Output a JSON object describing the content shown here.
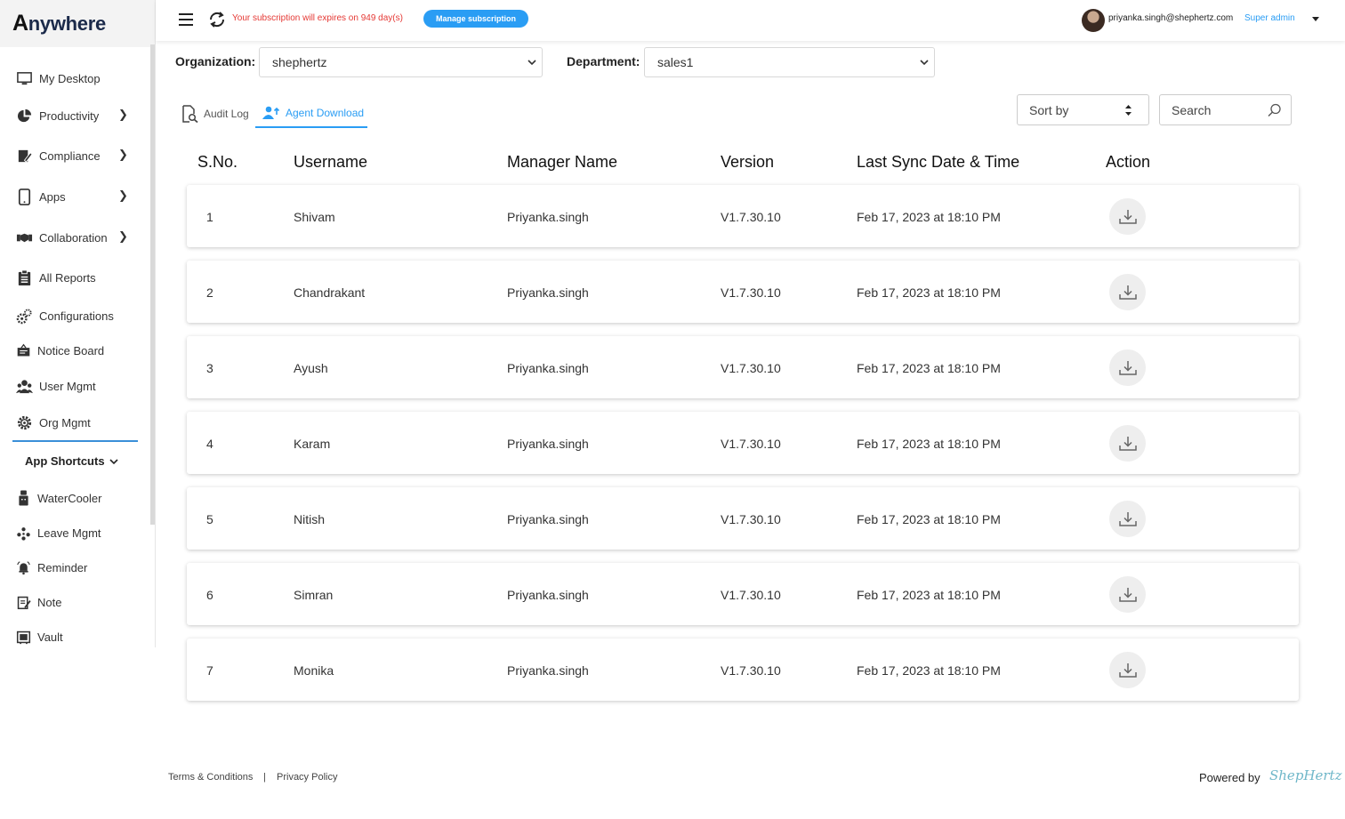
{
  "app": {
    "logo_letter": "A",
    "logo_rest": "nywhere"
  },
  "sidebar": {
    "items": [
      {
        "label": "My Desktop",
        "icon": "desktop-icon",
        "has_arrow": false
      },
      {
        "label": "Productivity",
        "icon": "pie-chart-icon",
        "has_arrow": true
      },
      {
        "label": "Compliance",
        "icon": "compliance-icon",
        "has_arrow": true
      },
      {
        "label": "Apps",
        "icon": "mobile-icon",
        "has_arrow": true
      },
      {
        "label": "Collaboration",
        "icon": "handshake-icon",
        "has_arrow": true
      },
      {
        "label": "All Reports",
        "icon": "clipboard-icon",
        "has_arrow": false
      },
      {
        "label": "Configurations",
        "icon": "gears-icon",
        "has_arrow": false
      },
      {
        "label": "Notice Board",
        "icon": "notice-board-icon",
        "has_arrow": false
      },
      {
        "label": "User Mgmt",
        "icon": "users-icon",
        "has_arrow": false
      },
      {
        "label": "Org Mgmt",
        "icon": "gear-icon",
        "has_arrow": false
      }
    ],
    "shortcuts_title": "App Shortcuts",
    "shortcuts": [
      {
        "label": "WaterCooler",
        "icon": "watercooler-icon"
      },
      {
        "label": "Leave Mgmt",
        "icon": "leave-icon"
      },
      {
        "label": "Reminder",
        "icon": "bell-icon"
      },
      {
        "label": "Note",
        "icon": "note-icon"
      },
      {
        "label": "Vault",
        "icon": "vault-icon"
      }
    ]
  },
  "header": {
    "subscription_text": "Your subscription will expires on 949 day(s)",
    "manage_label": "Manage subscription",
    "user_email": "priyanka.singh@shephertz.com",
    "user_role": "Super admin"
  },
  "filters": {
    "organization_label": "Organization:",
    "organization_value": "shephertz",
    "department_label": "Department:",
    "department_value": "sales1"
  },
  "tabs": {
    "audit_log": "Audit Log",
    "agent_download": "Agent Download"
  },
  "sort": {
    "label": "Sort by"
  },
  "search": {
    "placeholder": "Search"
  },
  "table": {
    "headers": [
      "S.No.",
      "Username",
      "Manager Name",
      "Version",
      "Last Sync Date & Time",
      "Action"
    ],
    "rows": [
      {
        "sno": "1",
        "username": "Shivam",
        "manager": "Priyanka.singh",
        "version": "V1.7.30.10",
        "last_sync": "Feb 17, 2023 at 18:10 PM"
      },
      {
        "sno": "2",
        "username": "Chandrakant",
        "manager": "Priyanka.singh",
        "version": "V1.7.30.10",
        "last_sync": "Feb 17, 2023 at 18:10 PM"
      },
      {
        "sno": "3",
        "username": "Ayush",
        "manager": "Priyanka.singh",
        "version": "V1.7.30.10",
        "last_sync": "Feb 17, 2023 at 18:10 PM"
      },
      {
        "sno": "4",
        "username": "Karam",
        "manager": "Priyanka.singh",
        "version": "V1.7.30.10",
        "last_sync": "Feb 17, 2023 at 18:10 PM"
      },
      {
        "sno": "5",
        "username": "Nitish",
        "manager": "Priyanka.singh",
        "version": "V1.7.30.10",
        "last_sync": "Feb 17, 2023 at 18:10 PM"
      },
      {
        "sno": "6",
        "username": "Simran",
        "manager": "Priyanka.singh",
        "version": "V1.7.30.10",
        "last_sync": "Feb 17, 2023 at 18:10 PM"
      },
      {
        "sno": "7",
        "username": "Monika",
        "manager": "Priyanka.singh",
        "version": "V1.7.30.10",
        "last_sync": "Feb 17, 2023 at 18:10 PM"
      }
    ]
  },
  "footer": {
    "terms": "Terms & Conditions",
    "separator": "|",
    "privacy": "Privacy Policy",
    "powered_by": "Powered by",
    "brand": "ShepHertz"
  },
  "colors": {
    "accent": "#2a9df4",
    "warning": "#e53935",
    "divider": "#3a8fd8"
  }
}
